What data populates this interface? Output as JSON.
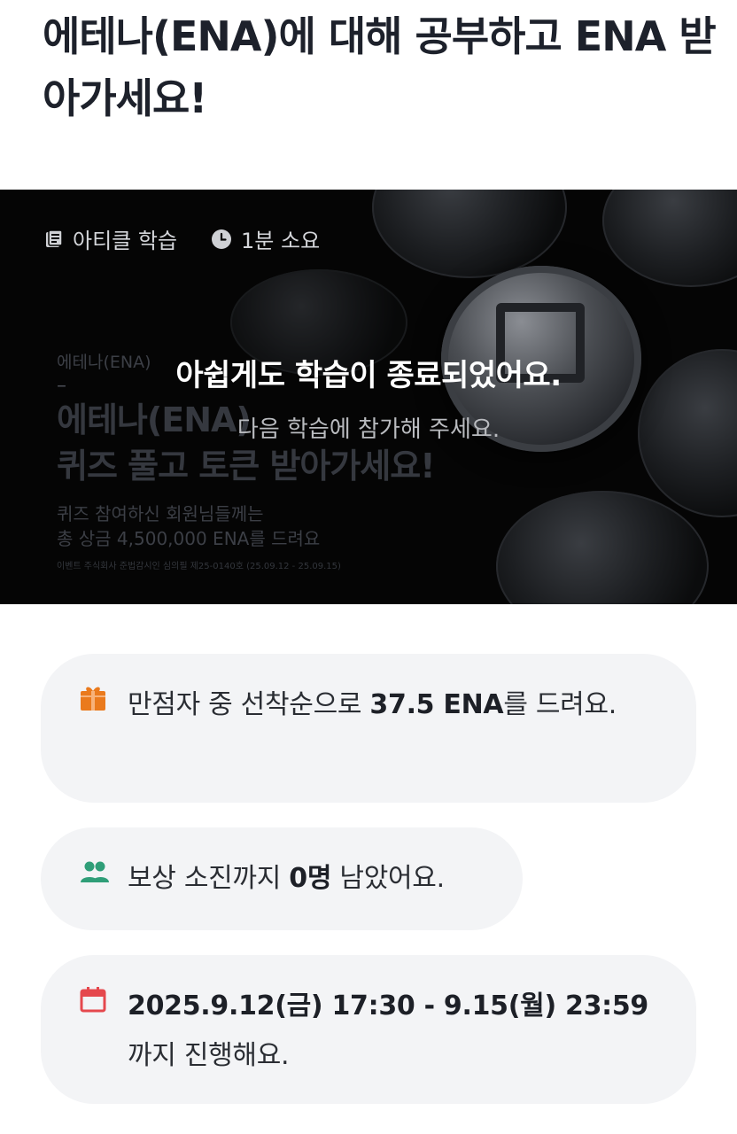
{
  "header": {
    "title": "에테나(ENA)에 대해 공부하고 ENA 받아가세요!"
  },
  "banner": {
    "meta": {
      "type_label": "아티클 학습",
      "duration_label": "1분 소요"
    },
    "promo": {
      "kicker": "에테나(ENA)",
      "dash": "–",
      "headline_line1": "에테나(ENA)",
      "headline_line2": "퀴즈 풀고 토큰 받아가세요!",
      "body_line1": "퀴즈 참여하신 회원님들께는",
      "body_line2": "총 상금 4,500,000 ENA를 드려요",
      "fine_print": "이벤트 주식회사 준법감시인 심의필 제25-0140호 (25.09.12 - 25.09.15)"
    },
    "status": {
      "title": "아쉽게도 학습이 종료되었어요.",
      "subtitle": "다음 학습에 참가해 주세요."
    }
  },
  "info": {
    "prize": {
      "prefix": "만점자 중 선착순으로 ",
      "amount": "37.5 ENA",
      "suffix": "를 드려요."
    },
    "remaining": {
      "prefix": "보상 소진까지 ",
      "count": "0명",
      "suffix": " 남았어요."
    },
    "period": {
      "range": "2025.9.12(금) 17:30 - 9.15(월) 23:59",
      "suffix": "까지 진행해요."
    }
  },
  "colors": {
    "gift_icon": "#ea7a1d",
    "people_icon": "#2f9e78",
    "calendar_icon": "#e5484d",
    "card_bg": "#f3f4f6",
    "banner_bg": "#050505"
  },
  "icons": [
    "book-icon",
    "clock-icon",
    "gift-icon",
    "people-icon",
    "calendar-icon"
  ]
}
